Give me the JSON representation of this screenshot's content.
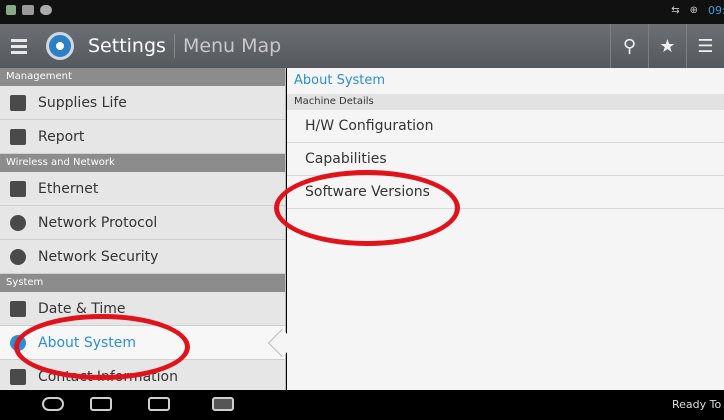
{
  "statusbar": {
    "clock": "09:"
  },
  "appbar": {
    "title": "Settings",
    "subtitle": "Menu Map",
    "actions": [
      "search-icon",
      "star-icon",
      "menu-icon"
    ]
  },
  "sidebar": {
    "sections": [
      {
        "header": "Management",
        "items": [
          "Supplies Life",
          "Report"
        ]
      },
      {
        "header": "Wireless and Network",
        "items": [
          "Ethernet",
          "Network Protocol",
          "Network Security"
        ]
      },
      {
        "header": "System",
        "items": [
          "Date & Time",
          "About System",
          "Contact Information"
        ]
      }
    ],
    "active_item": "About System"
  },
  "main": {
    "title": "About System",
    "subheader": "Machine Details",
    "items": [
      "H/W Configuration",
      "Capabilities",
      "Software Versions"
    ]
  },
  "navbar": {
    "status": "Ready To Cop"
  },
  "colors": {
    "accent": "#2b8fd6",
    "highlight_ring": "#e2121b"
  }
}
